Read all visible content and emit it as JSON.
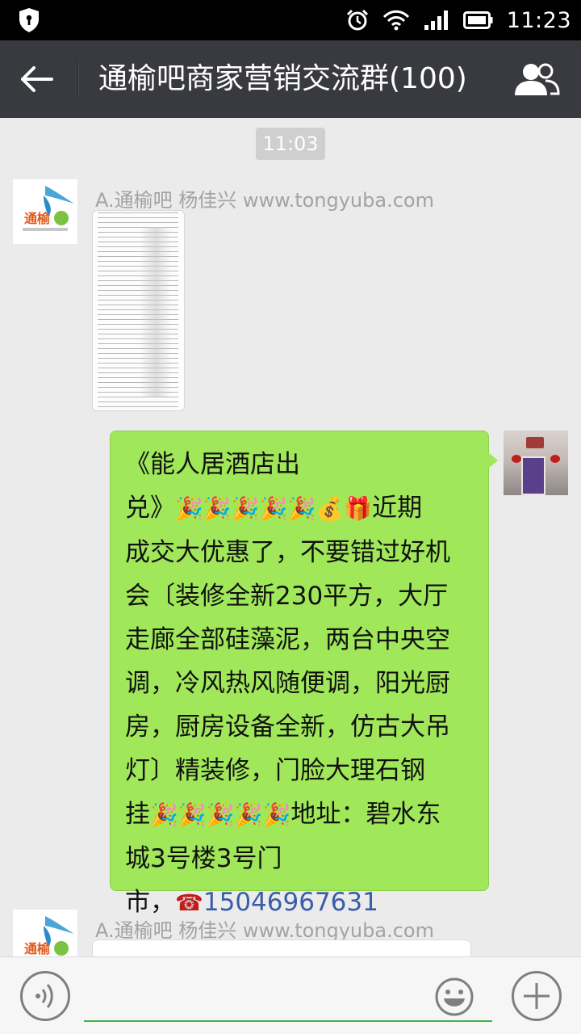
{
  "status_bar": {
    "time": "11:23",
    "icons": [
      "shield-icon",
      "alarm-icon",
      "wifi-icon",
      "signal-icon",
      "battery-icon"
    ]
  },
  "header": {
    "title": "通榆吧商家营销交流群(100)",
    "back_icon": "back-arrow-icon",
    "members_icon": "group-members-icon",
    "background": "#393a3f"
  },
  "chat": {
    "timestamp": "11:03",
    "messages": [
      {
        "sender": "A.通榆吧 杨佳兴 www.tongyuba.com",
        "avatar_text": "通榆",
        "type": "image"
      },
      {
        "self": true,
        "type": "text",
        "lines": [
          "《能人居酒店出",
          "兑》",
          "近期",
          "成交大优惠了，不要错过好机",
          "会〔装修全新230平方，大厅",
          "走廊全部硅藻泥，两台中央空",
          "调，冷风热风随便调，阳光厨",
          "房，厨房设备全新，仿古大吊",
          "灯〕精装修，门脸大理石钢",
          "挂",
          "地址：碧水东",
          "城3号楼3号门",
          "市，"
        ],
        "phone": "15046967631",
        "emojis": {
          "party": "🎉",
          "money": "💰",
          "gift": "🎁",
          "telephone": "☎"
        },
        "bubble_color": "#a0e75a"
      },
      {
        "sender": "A.通榆吧 杨佳兴 www.tongyuba.com",
        "avatar_text": "通榆",
        "type": "text"
      }
    ]
  },
  "input_bar": {
    "voice_icon": "voice-icon",
    "emoji_icon": "emoji-icon",
    "plus_icon": "plus-icon",
    "placeholder": "",
    "accent": "#42b34a"
  }
}
